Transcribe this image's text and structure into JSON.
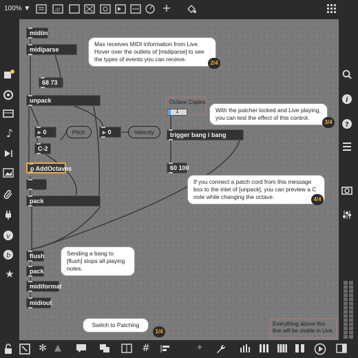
{
  "toolbar": {
    "zoom": "100%",
    "zoom_caret": "▼"
  },
  "objects": {
    "midiin": "midiin",
    "midiparse": "midiparse",
    "msg_68_73": "68 73",
    "unpack": "unpack",
    "num_pitch": "0",
    "pitch_label": "Pitch",
    "num_velocity": "0",
    "velocity_label": "Velocity",
    "note_c2": "C-2",
    "p_addoctaves": "p AddOctaves",
    "pack": "pack",
    "flush": "flush",
    "pack2": "pack",
    "midiformat": "midiformat",
    "midiout": "midiout",
    "octave_copies_label": "Octave Copies",
    "octave_copies_value": "1",
    "trigger": "trigger bang i bang",
    "msg_60_100": "60 100"
  },
  "comments": {
    "c1": "Max receives MIDI information from Live. Hover over the outlets of [midiparse] to see the types of events you can receive.",
    "c1_badge": "2/4",
    "c2": "With the patcher locked and Live playing, you can test the effect of this control.",
    "c2_badge": "3/4",
    "c3": "If you connect a patch cord from this message box to the inlet of [unpack], you can preview a C note while changing the octave.",
    "c3_badge": "4/4",
    "c4": "Sending a bang to [flush] stops all playing notes.",
    "switch": "Switch to Patching",
    "switch_badge": "1/4",
    "everything": "Everything above this line will be visible in Live."
  },
  "colors": {
    "accent": "#f2a93b",
    "canvas": "#7b7b7b",
    "chrome": "#2b2b2b"
  }
}
